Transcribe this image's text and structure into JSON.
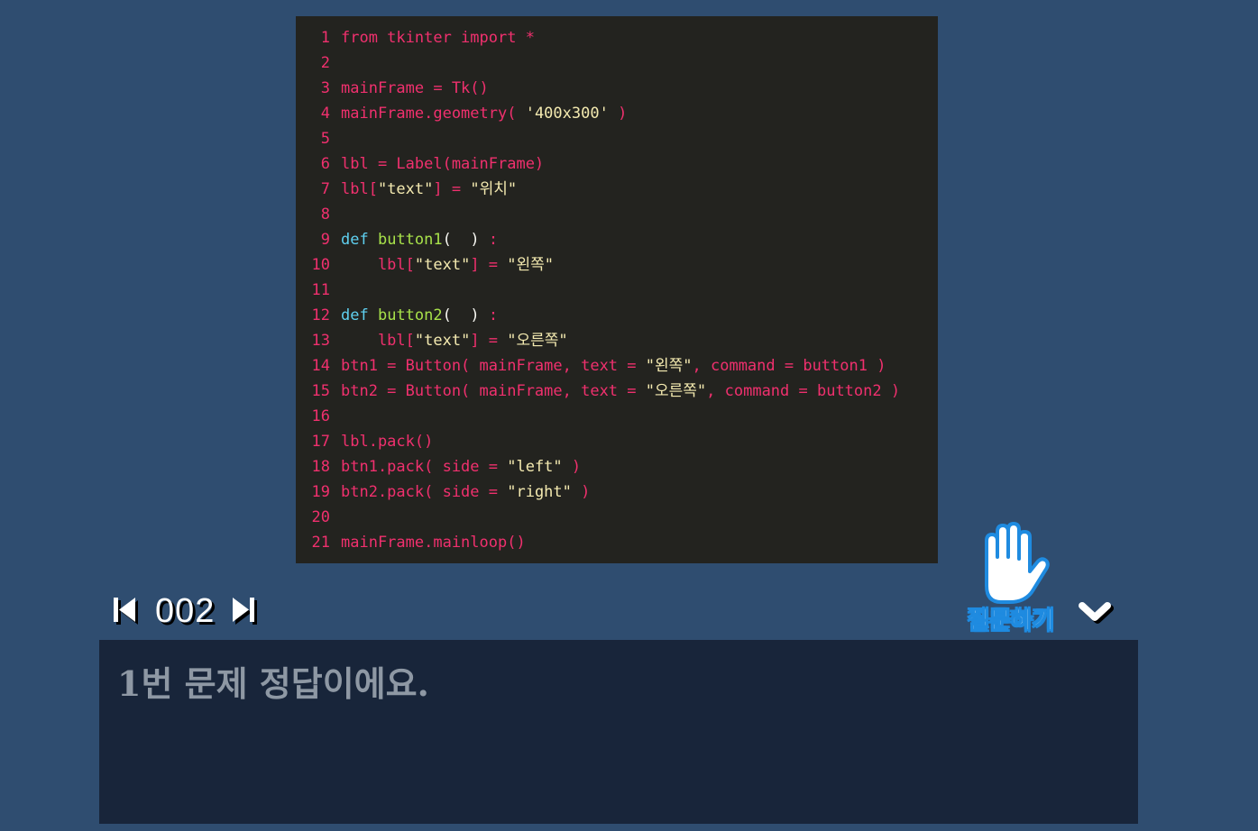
{
  "code_panel": {
    "lines": [
      {
        "n": "1",
        "tokens": [
          {
            "t": "from tkinter import *",
            "c": ""
          }
        ]
      },
      {
        "n": "2",
        "tokens": []
      },
      {
        "n": "3",
        "tokens": [
          {
            "t": "mainFrame = Tk()",
            "c": ""
          }
        ]
      },
      {
        "n": "4",
        "tokens": [
          {
            "t": "mainFrame.geometry( ",
            "c": ""
          },
          {
            "t": "'400x300'",
            "c": "tk-str"
          },
          {
            "t": " )",
            "c": ""
          }
        ]
      },
      {
        "n": "5",
        "tokens": []
      },
      {
        "n": "6",
        "tokens": [
          {
            "t": "lbl = Label(mainFrame)",
            "c": ""
          }
        ]
      },
      {
        "n": "7",
        "tokens": [
          {
            "t": "lbl[",
            "c": ""
          },
          {
            "t": "\"text\"",
            "c": "tk-str"
          },
          {
            "t": "] = ",
            "c": ""
          },
          {
            "t": "\"위치\"",
            "c": "tk-str"
          }
        ]
      },
      {
        "n": "8",
        "tokens": []
      },
      {
        "n": "9",
        "tokens": [
          {
            "t": "def",
            "c": "tk-kw"
          },
          {
            "t": " ",
            "c": ""
          },
          {
            "t": "button1",
            "c": "tk-fn"
          },
          {
            "t": "(  )",
            "c": "tk-wht"
          },
          {
            "t": " :",
            "c": ""
          }
        ]
      },
      {
        "n": "10",
        "tokens": [
          {
            "t": "    lbl[",
            "c": ""
          },
          {
            "t": "\"text\"",
            "c": "tk-str"
          },
          {
            "t": "] = ",
            "c": ""
          },
          {
            "t": "\"왼쪽\"",
            "c": "tk-str"
          }
        ]
      },
      {
        "n": "11",
        "tokens": []
      },
      {
        "n": "12",
        "tokens": [
          {
            "t": "def",
            "c": "tk-kw"
          },
          {
            "t": " ",
            "c": ""
          },
          {
            "t": "button2",
            "c": "tk-fn"
          },
          {
            "t": "(  )",
            "c": "tk-wht"
          },
          {
            "t": " :",
            "c": ""
          }
        ]
      },
      {
        "n": "13",
        "tokens": [
          {
            "t": "    lbl[",
            "c": ""
          },
          {
            "t": "\"text\"",
            "c": "tk-str"
          },
          {
            "t": "] = ",
            "c": ""
          },
          {
            "t": "\"오른쪽\"",
            "c": "tk-str"
          }
        ]
      },
      {
        "n": "14",
        "tokens": [
          {
            "t": "btn1 = Button( mainFrame, text = ",
            "c": ""
          },
          {
            "t": "\"왼쪽\"",
            "c": "tk-str"
          },
          {
            "t": ", command = button1 )",
            "c": ""
          }
        ]
      },
      {
        "n": "15",
        "tokens": [
          {
            "t": "btn2 = Button( mainFrame, text = ",
            "c": ""
          },
          {
            "t": "\"오른쪽\"",
            "c": "tk-str"
          },
          {
            "t": ", command = button2 )",
            "c": ""
          }
        ]
      },
      {
        "n": "16",
        "tokens": []
      },
      {
        "n": "17",
        "tokens": [
          {
            "t": "lbl.pack()",
            "c": ""
          }
        ]
      },
      {
        "n": "18",
        "tokens": [
          {
            "t": "btn1.pack( side = ",
            "c": ""
          },
          {
            "t": "\"left\"",
            "c": "tk-str"
          },
          {
            "t": " )",
            "c": ""
          }
        ]
      },
      {
        "n": "19",
        "tokens": [
          {
            "t": "btn2.pack( side = ",
            "c": ""
          },
          {
            "t": "\"right\"",
            "c": "tk-str"
          },
          {
            "t": " )",
            "c": ""
          }
        ]
      },
      {
        "n": "20",
        "tokens": []
      },
      {
        "n": "21",
        "tokens": [
          {
            "t": "mainFrame.mainloop()",
            "c": ""
          }
        ]
      }
    ]
  },
  "nav": {
    "page_number": "002",
    "prev_icon": "skip-previous-icon",
    "next_icon": "skip-next-icon"
  },
  "ask": {
    "label": "질문하기",
    "icon": "raised-hand-icon"
  },
  "collapse": {
    "icon": "chevron-down-icon"
  },
  "message": {
    "text": "1번 문제 정답이에요."
  },
  "colors": {
    "background": "#2f4d70",
    "code_bg": "#23231f",
    "code_text": "#f0306e",
    "keyword": "#5fd0f0",
    "function_name": "#a8e24a",
    "string": "#f4eab0",
    "message_bg": "#18253a",
    "message_text": "#8e98a4",
    "ask_accent": "#1f8be0"
  }
}
